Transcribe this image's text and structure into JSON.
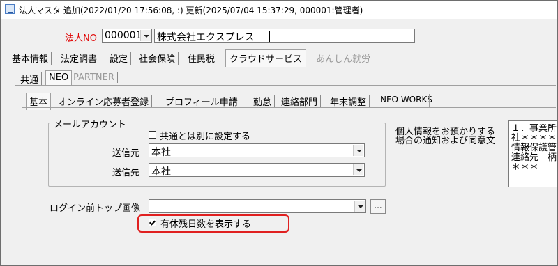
{
  "window": {
    "title": "法人マスタ 追加(2022/01/20 17:56:08, :) 更新(2025/07/04 15:37:29, 000001:管理者)"
  },
  "company": {
    "label": "法人NO",
    "number_value": "000001",
    "name_value": "株式会社エクスプレス"
  },
  "tabs_main": [
    "基本情報",
    "法定調書",
    "設定",
    "社会保険",
    "住民税",
    "クラウドサービス",
    "あんしん就労"
  ],
  "tabs_cloud": [
    "共通",
    "NEO",
    "PARTNER"
  ],
  "tabs_neo": [
    "基本",
    "オンライン応募者登録",
    "プロフィール申請",
    "勤怠",
    "連絡部門",
    "年末調整",
    "NEO WORKS"
  ],
  "mail_account": {
    "group_label": "メールアカウント",
    "separate_checkbox_label": "共通とは別に設定する",
    "sender_label": "送信元",
    "sender_value": "本社",
    "recipient_label": "送信先",
    "recipient_value": "本社"
  },
  "login_image": {
    "label": "ログイン前トップ画像",
    "value": "",
    "browse_label": "..."
  },
  "paid_leave_checkbox": {
    "label": "有休残日数を表示する",
    "checked": true
  },
  "privacy": {
    "label_line1": "個人情報をお預かりする",
    "label_line2": "場合の通知および同意文",
    "text": "１．事業所\n社＊＊＊＊\n情報保護管\n連絡先　柄\n＊＊＊"
  },
  "colors": {
    "highlight": "#e02020",
    "label_red": "#e00000"
  }
}
